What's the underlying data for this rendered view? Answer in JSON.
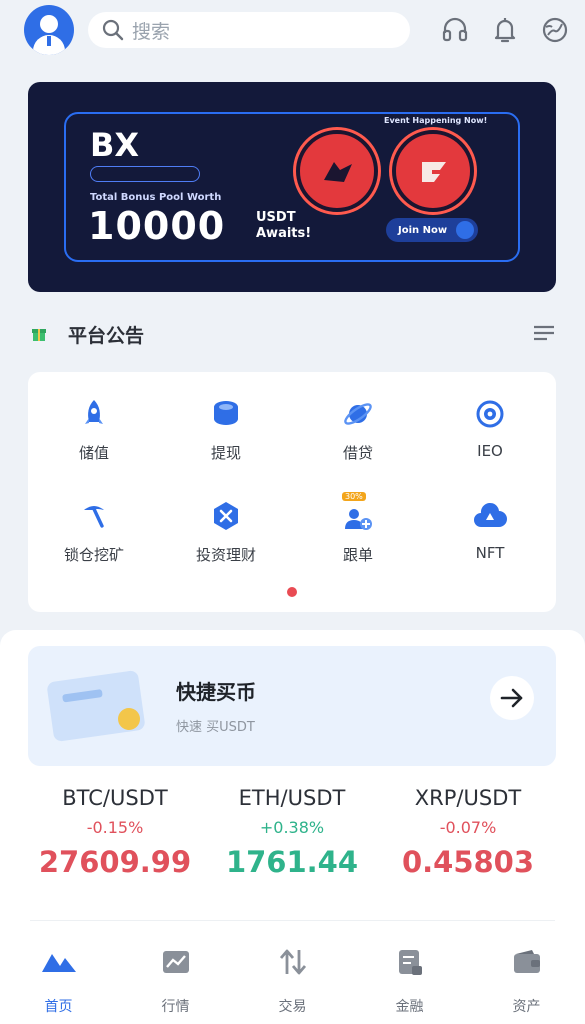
{
  "header": {
    "search_placeholder": "搜索",
    "icons": [
      "avatar",
      "search-icon",
      "headset-icon",
      "bell-icon",
      "globe-icon"
    ]
  },
  "banner": {
    "title_partial": "BX",
    "event_text": "Event Happening Now!",
    "pool_text": "Total Bonus Pool Worth",
    "amount": "10000",
    "currency": "USDT",
    "awaits": "Awaits!",
    "join_label": "Join Now"
  },
  "notice": {
    "title": "平台公告"
  },
  "grid": {
    "items": [
      {
        "label": "储值",
        "icon": "rocket-icon"
      },
      {
        "label": "提现",
        "icon": "coins-icon"
      },
      {
        "label": "借贷",
        "icon": "planet-icon"
      },
      {
        "label": "IEO",
        "icon": "target-icon"
      },
      {
        "label": "锁仓挖矿",
        "icon": "pickaxe-icon"
      },
      {
        "label": "投资理财",
        "icon": "hexagon-icon"
      },
      {
        "label": "跟单",
        "icon": "follow-icon",
        "badge": "30%"
      },
      {
        "label": "NFT",
        "icon": "cloud-icon"
      }
    ],
    "page": 1
  },
  "quick_buy": {
    "title": "快捷买币",
    "subtitle": "快速 买USDT"
  },
  "tickers": [
    {
      "pair": "BTC/USDT",
      "change": "-0.15%",
      "price": "27609.99",
      "direction": "down"
    },
    {
      "pair": "ETH/USDT",
      "change": "+0.38%",
      "price": "1761.44",
      "direction": "up"
    },
    {
      "pair": "XRP/USDT",
      "change": "-0.07%",
      "price": "0.45803",
      "direction": "down"
    }
  ],
  "tabs": [
    {
      "label": "首页",
      "icon": "home-icon",
      "active": true
    },
    {
      "label": "行情",
      "icon": "chart-icon",
      "active": false
    },
    {
      "label": "交易",
      "icon": "swap-icon",
      "active": false
    },
    {
      "label": "金融",
      "icon": "finance-icon",
      "active": false
    },
    {
      "label": "资产",
      "icon": "wallet-icon",
      "active": false
    }
  ],
  "colors": {
    "accent": "#2f6ee6",
    "up": "#2fb38b",
    "down": "#e0515c",
    "background": "#eef2f7"
  }
}
